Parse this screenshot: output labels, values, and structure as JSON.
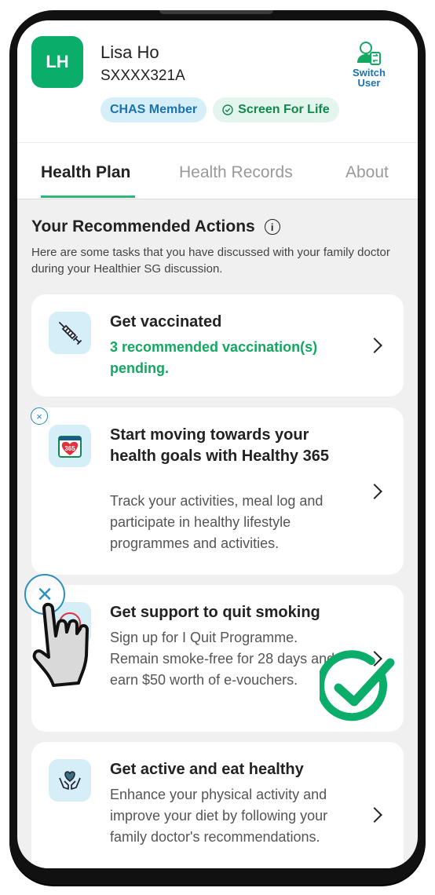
{
  "user": {
    "initials": "LH",
    "name": "Lisa Ho",
    "id": "SXXXX321A",
    "badges": [
      {
        "label": "CHAS Member",
        "icon": "none"
      },
      {
        "label": "Screen For Life",
        "icon": "check-circle-icon"
      }
    ],
    "switch_user_label_line1": "Switch",
    "switch_user_label_line2": "User"
  },
  "tabs": [
    {
      "label": "Health Plan",
      "active": true
    },
    {
      "label": "Health Records",
      "active": false
    },
    {
      "label": "About",
      "active": false
    }
  ],
  "section": {
    "title": "Your Recommended Actions",
    "description": "Here are some tasks that you have discussed with your family doctor during your Healthier SG discussion."
  },
  "actions": [
    {
      "icon": "syringe-icon",
      "title": "Get vaccinated",
      "status": "3 recommended vaccination(s) pending."
    },
    {
      "icon": "calendar-365-heart-icon",
      "title": "Start moving towards your health goals with Healthy 365",
      "description": "Track your activities, meal log and participate in healthy lifestyle programmes and activities.",
      "dismissible": true
    },
    {
      "icon": "no-smoking-icon",
      "title": "Get support to quit smoking",
      "description": "Sign up for I Quit Programme. Remain smoke-free for 28 days and earn $50 worth of e-vouchers.",
      "dismissible": true
    },
    {
      "icon": "heart-hands-icon",
      "title": "Get active and eat healthy",
      "description": "Enhance your physical activity and improve your diet by following your family doctor's recommendations."
    }
  ],
  "colors": {
    "brand_green": "#0aad6a",
    "link_blue": "#1a73b0",
    "status_green": "#12a860"
  },
  "dismiss_symbol": "×"
}
